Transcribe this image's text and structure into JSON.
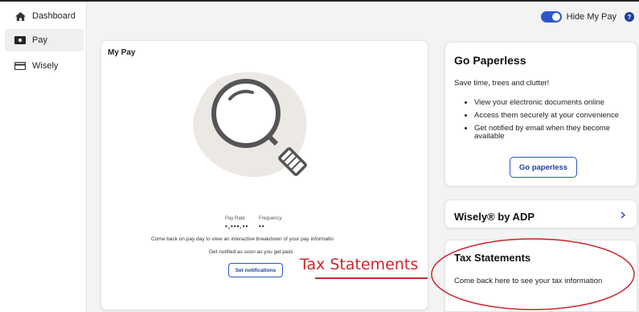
{
  "sidebar": {
    "items": [
      {
        "label": "Dashboard",
        "icon": "home-icon"
      },
      {
        "label": "Pay",
        "icon": "pay-icon"
      },
      {
        "label": "Wisely",
        "icon": "card-icon"
      }
    ]
  },
  "header": {
    "toggle_label": "Hide My Pay",
    "toggle_on": true,
    "help_icon": "help-icon"
  },
  "my_pay": {
    "title": "My Pay",
    "pay_rate_label": "Pay Rate",
    "frequency_label": "Frequency",
    "pay_rate_value": "•,•••.••",
    "frequency_value": "••",
    "note": "Come back on pay day to view an interactive breakdown of your pay informatio",
    "notify_note": "Get notified as soon as you get paid.",
    "button_label": "Set notifications"
  },
  "go_paperless": {
    "title": "Go Paperless",
    "subtitle": "Save time, trees and clutter!",
    "bullets": [
      "View your electronic documents online",
      "Access them securely at your convenience",
      "Get notified by email when they become available"
    ],
    "button_label": "Go paperless"
  },
  "wisely_card": {
    "title": "Wisely® by ADP",
    "chevron_icon": "chevron-right-icon"
  },
  "tax_statements": {
    "title": "Tax Statements",
    "subtitle": "Come back here to see your tax information"
  },
  "annotation": {
    "text": "Tax Statements",
    "color": "#c8282f"
  },
  "colors": {
    "accent": "#2f55c9",
    "accent_dark": "#1d3f99",
    "annotation": "#c8282f"
  }
}
